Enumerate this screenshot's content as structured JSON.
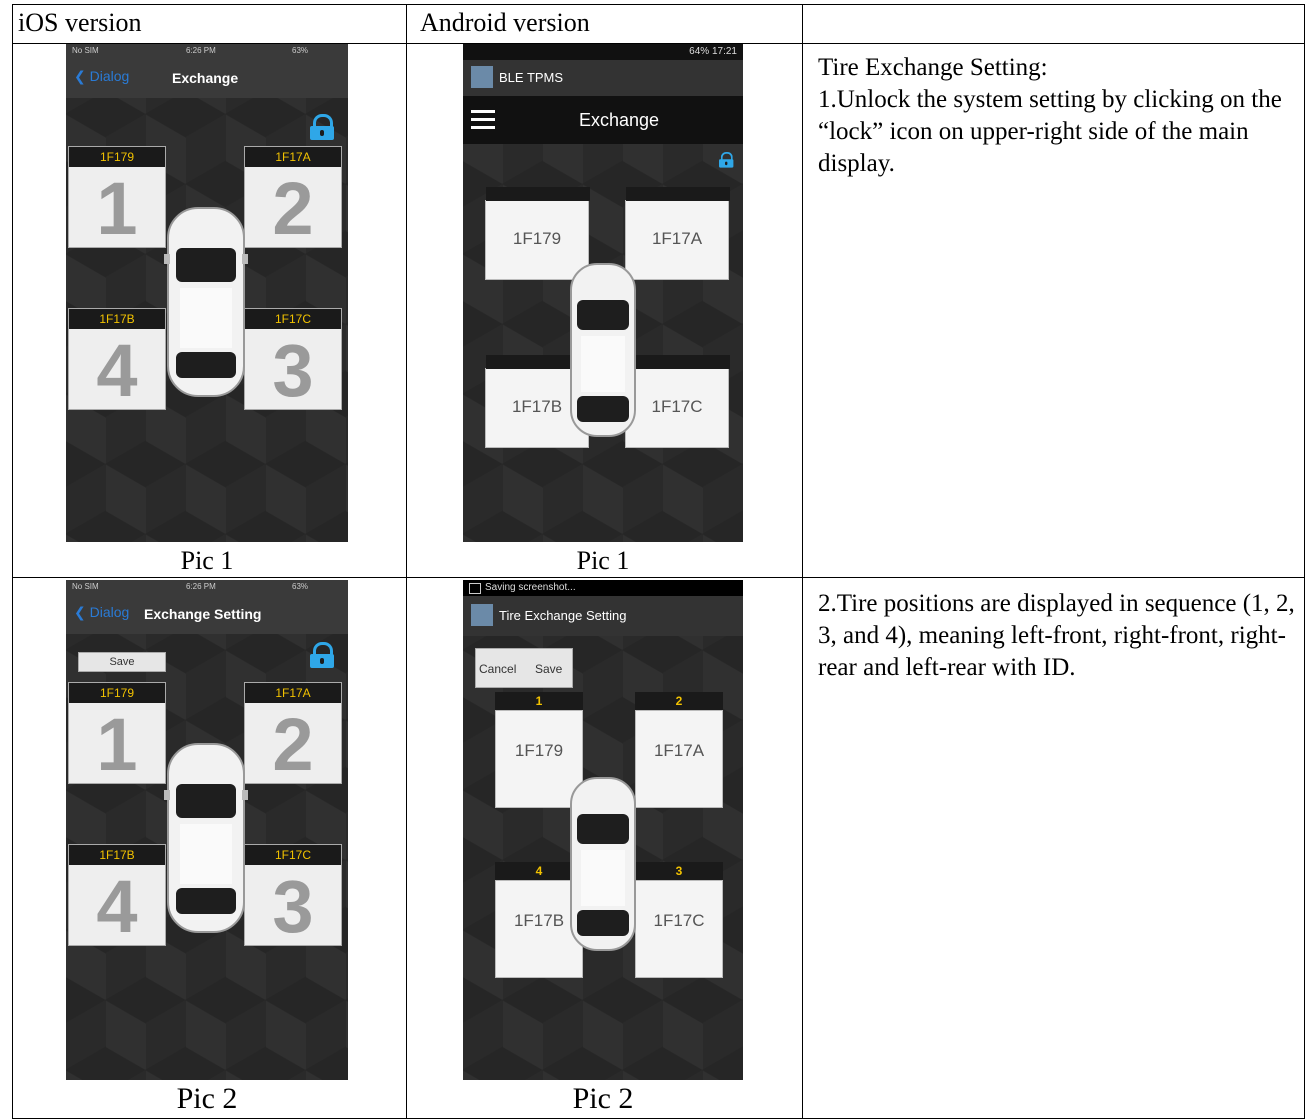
{
  "headers": {
    "ios": "iOS version",
    "android": "Android version",
    "third": ""
  },
  "row1": {
    "ios_caption": "Pic 1",
    "android_caption": "Pic 1",
    "description": [
      "Tire Exchange Setting:",
      "1.Unlock the system setting by clicking on the “lock” icon on upper-right side of the main display."
    ],
    "ios_screen": {
      "status_left": "No SIM",
      "status_time": "6:26 PM",
      "status_right": "63%",
      "back_label": "Dialog",
      "title": "Exchange",
      "tiles": [
        {
          "id": "1F179",
          "num": "1"
        },
        {
          "id": "1F17A",
          "num": "2"
        },
        {
          "id": "1F17B",
          "num": "4"
        },
        {
          "id": "1F17C",
          "num": "3"
        }
      ]
    },
    "android_screen": {
      "status_right": "64% 17:21",
      "app_name": "BLE TPMS",
      "title": "Exchange",
      "tiles": [
        "1F179",
        "1F17A",
        "1F17B",
        "1F17C"
      ]
    }
  },
  "row2": {
    "ios_caption": "Pic 2",
    "android_caption": "Pic 2",
    "description": [
      "2.Tire positions are displayed in sequence (1, 2, 3, and 4), meaning left-front, right-front, right-rear and left-rear with ID."
    ],
    "ios_screen": {
      "status_left": "No SIM",
      "status_time": "6:26 PM",
      "status_right": "63%",
      "back_label": "Dialog",
      "title": "Exchange Setting",
      "save_label": "Save",
      "tiles": [
        {
          "id": "1F179",
          "num": "1"
        },
        {
          "id": "1F17A",
          "num": "2"
        },
        {
          "id": "1F17B",
          "num": "4"
        },
        {
          "id": "1F17C",
          "num": "3"
        }
      ]
    },
    "android_screen": {
      "status_left": "Saving screenshot...",
      "title": "Tire Exchange Setting",
      "cancel_label": "Cancel",
      "save_label": "Save",
      "tiles": [
        {
          "pos": "1",
          "id": "1F179"
        },
        {
          "pos": "2",
          "id": "1F17A"
        },
        {
          "pos": "4",
          "id": "1F17B"
        },
        {
          "pos": "3",
          "id": "1F17C"
        }
      ]
    }
  },
  "colors": {
    "lock": "#2fa7e8",
    "id_text": "#f2c200",
    "ios_back": "#2a7bd6"
  }
}
